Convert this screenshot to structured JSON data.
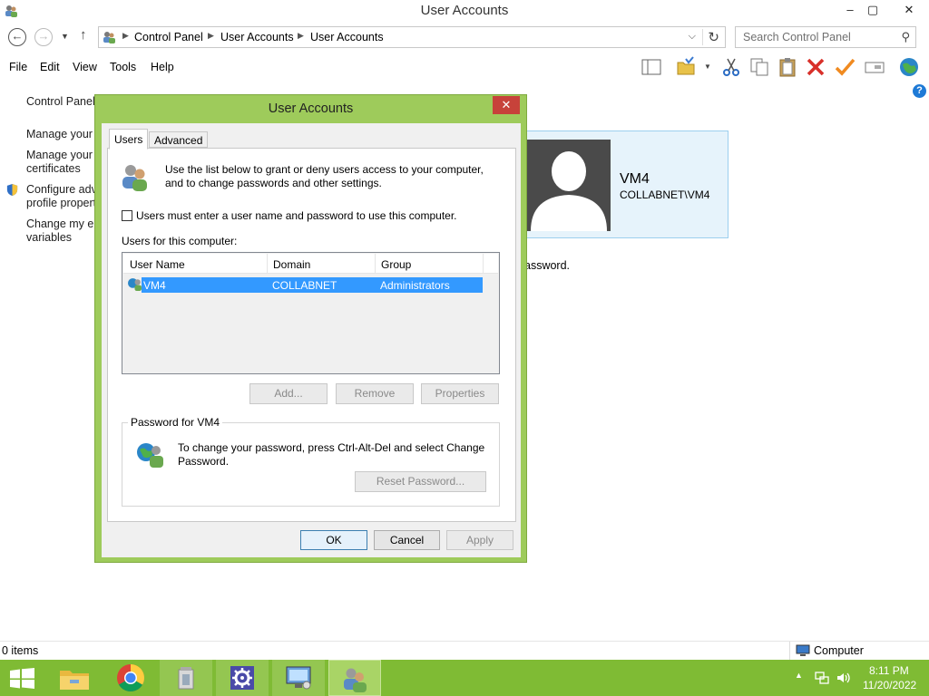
{
  "window": {
    "title": "User Accounts",
    "controls": [
      "–",
      "▢",
      "✕"
    ]
  },
  "address": {
    "crumbs": [
      "Control Panel",
      "User Accounts",
      "User Accounts"
    ],
    "search_placeholder": "Search Control Panel"
  },
  "menu": [
    "File",
    "Edit",
    "View",
    "Tools",
    "Help"
  ],
  "toolbar_icons": [
    "layout-icon",
    "folder-options-icon",
    "cut-icon",
    "copy-icon",
    "paste-icon",
    "delete-icon",
    "properties-icon",
    "rename-icon",
    "globe-icon"
  ],
  "leftnav": {
    "items": [
      "Control Panel",
      "Manage your c",
      "Manage your f",
      "certificates",
      "Configure adv",
      "profile propert",
      "Change my en",
      "variables"
    ]
  },
  "user_card": {
    "name": "VM4",
    "domain": "COLLABNET\\VM4"
  },
  "background_text": "assword.",
  "status": {
    "items": "0 items",
    "location": "Computer"
  },
  "dialog": {
    "title": "User Accounts",
    "close": "✕",
    "tabs": [
      "Users",
      "Advanced"
    ],
    "intro_line1": "Use the list below to grant or deny users access to your computer,",
    "intro_line2": "and to change passwords and other settings.",
    "checkbox_label": "Users must enter a user name and password to use this computer.",
    "checkbox_checked": false,
    "list_label": "Users for this computer:",
    "columns": [
      "User Name",
      "Domain",
      "Group"
    ],
    "rows": [
      {
        "name": "VM4",
        "domain": "COLLABNET",
        "group": "Administrators"
      }
    ],
    "buttons": {
      "add": "Add...",
      "remove": "Remove",
      "properties": "Properties"
    },
    "password_group_title": "Password for VM4",
    "password_text_line1": "To change your password, press Ctrl-Alt-Del and select Change",
    "password_text_line2": "Password.",
    "reset_password": "Reset Password...",
    "ok": "OK",
    "cancel": "Cancel",
    "apply": "Apply"
  },
  "taskbar": {
    "apps": [
      "start-icon",
      "file-explorer-icon",
      "chrome-icon",
      "recycle-tool-icon",
      "settings-icon",
      "remote-desktop-icon",
      "user-accounts-icon"
    ],
    "time": "8:11 PM",
    "date": "11/20/2022"
  },
  "colors": {
    "accent": "#9ecb5b",
    "taskbar": "#7fbb34",
    "selection": "#3399ff",
    "close": "#c7423a"
  }
}
